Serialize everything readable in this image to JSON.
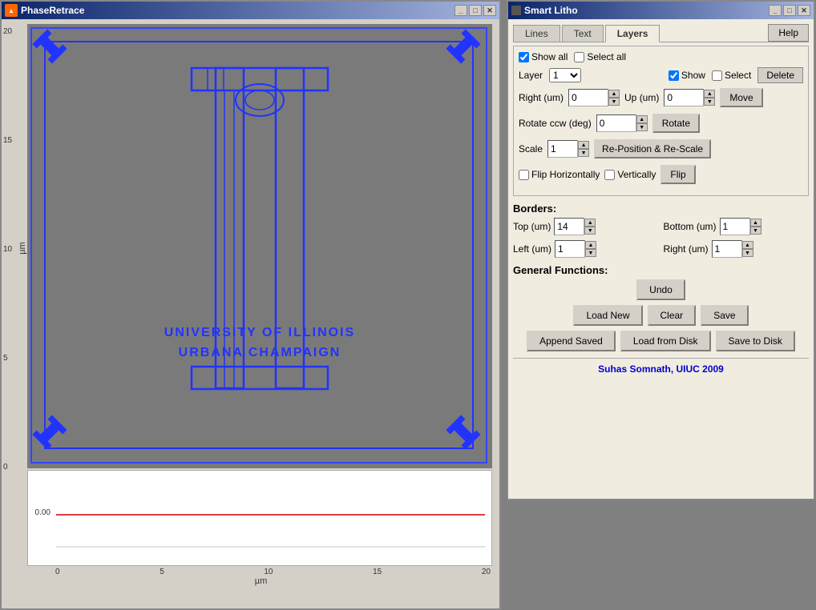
{
  "phaseretrace": {
    "title": "PhaseRetrace",
    "yaxis_label": "µm",
    "yticks": [
      "20",
      "15",
      "10",
      "5",
      "0"
    ],
    "xticks": [
      "0",
      "5",
      "10",
      "15",
      "20"
    ],
    "xlabel": "µm",
    "y_bottom_ticks": [
      "0.00"
    ],
    "text_line1": "UNIVERSITY OF ILLINOIS",
    "text_line2": "URBANA CHAMPAIGN"
  },
  "smartlitho": {
    "title": "Smart Litho",
    "tabs": {
      "lines": "Lines",
      "text": "Text",
      "layers": "Layers",
      "active": "Layers"
    },
    "help_label": "Help",
    "show_all_label": "Show all",
    "select_all_label": "Select all",
    "layer_label": "Layer",
    "layer_value": "1",
    "show_label": "Show",
    "select_label": "Select",
    "delete_label": "Delete",
    "right_um_label": "Right (um)",
    "right_um_value": "0",
    "up_um_label": "Up (um)",
    "up_um_value": "0",
    "move_label": "Move",
    "rotate_label": "Rotate ccw (deg)",
    "rotate_value": "0",
    "rotate_btn": "Rotate",
    "scale_label": "Scale",
    "scale_value": "1",
    "reposition_btn": "Re-Position & Re-Scale",
    "flip_h_label": "Flip Horizontally",
    "flip_v_label": "Vertically",
    "flip_btn": "Flip",
    "borders_label": "Borders:",
    "top_um_label": "Top (um)",
    "top_um_value": "14",
    "bottom_um_label": "Bottom (um)",
    "bottom_um_value": "1",
    "left_um_label": "Left (um)",
    "left_um_value": "1",
    "right2_um_label": "Right (um)",
    "right2_um_value": "1",
    "general_label": "General Functions:",
    "undo_label": "Undo",
    "load_new_label": "Load New",
    "clear_label": "Clear",
    "save_label": "Save",
    "append_saved_label": "Append Saved",
    "load_from_disk_label": "Load from Disk",
    "save_to_disk_label": "Save to Disk",
    "footer_text": "Suhas Somnath, UIUC 2009"
  }
}
